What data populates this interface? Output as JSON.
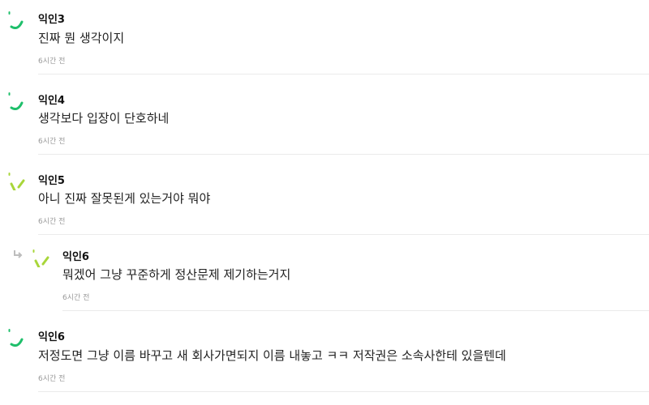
{
  "comments": [
    {
      "author": "익인3",
      "text": "진짜 뭔 생각이지",
      "time": "6시간 전",
      "avatar_icon": "smile-curve-icon",
      "avatar_color": "#1fbf6b",
      "is_reply": false
    },
    {
      "author": "익인4",
      "text": "생각보다 입장이 단호하네",
      "time": "6시간 전",
      "avatar_icon": "smile-curve-icon",
      "avatar_color": "#1fbf6b",
      "is_reply": false
    },
    {
      "author": "익인5",
      "text": "아니 진짜 잘못된게 있는거야 뭐야",
      "time": "6시간 전",
      "avatar_icon": "wink-icon",
      "avatar_color": "#a8d63a",
      "is_reply": false
    },
    {
      "author": "익인6",
      "text": "뭐겠어 그냥 꾸준하게 정산문제 제기하는거지",
      "time": "6시간 전",
      "avatar_icon": "wink-icon",
      "avatar_color": "#a8d63a",
      "is_reply": true
    },
    {
      "author": "익인6",
      "text": "저정도면 그냥 이름 바꾸고 새 회사가면되지 이름 내놓고 ㅋㅋ 저작권은 소속사한테 있을텐데",
      "time": "6시간 전",
      "avatar_icon": "smile-curve-icon",
      "avatar_color": "#1fbf6b",
      "is_reply": false
    }
  ],
  "reply_icon": "reply-arrow-icon"
}
